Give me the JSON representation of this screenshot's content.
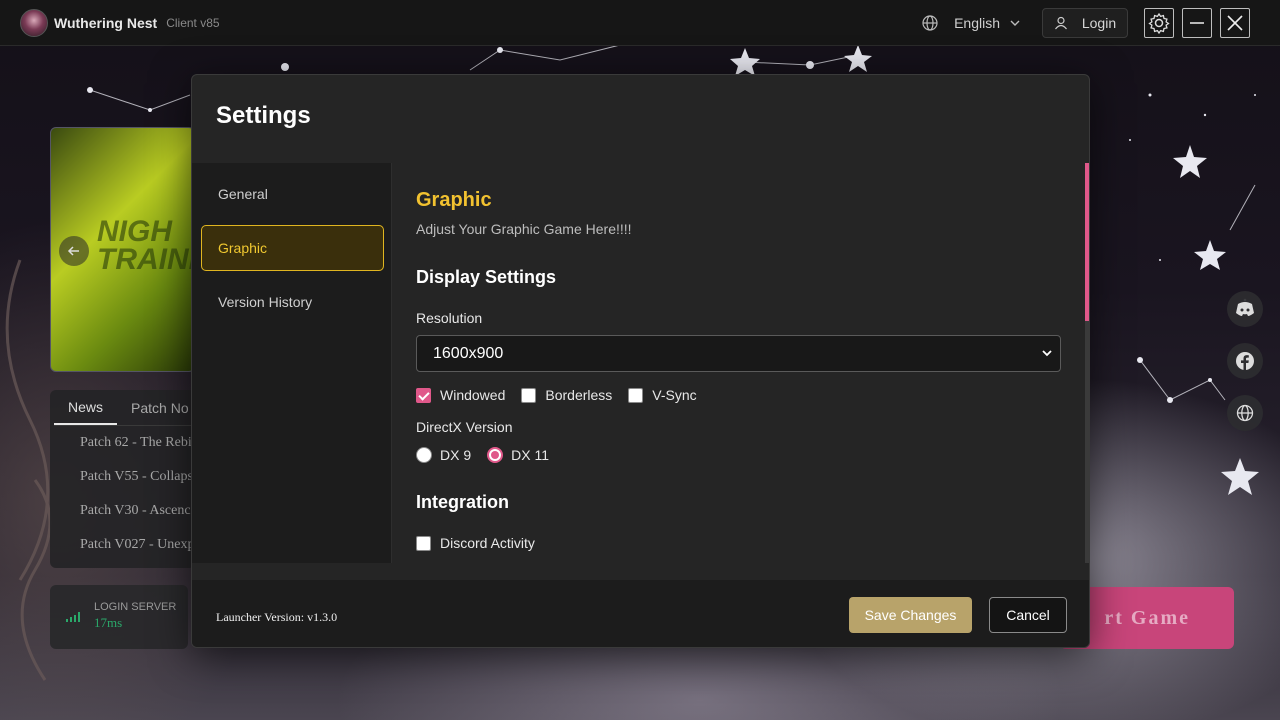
{
  "app": {
    "title": "Wuthering Nest",
    "client_version": "Client v85"
  },
  "topbar": {
    "language": "English",
    "login_label": "Login"
  },
  "banner": {
    "text": "NIGH\nTRAINI"
  },
  "news": {
    "tabs": [
      "News",
      "Patch No"
    ],
    "items": [
      "Patch 62 - The Rebi",
      "Patch V55 - Collaps",
      "Patch V30 - Ascenc",
      "Patch V027 - Unexp"
    ]
  },
  "server": {
    "label": "LOGIN SERVER",
    "ping": "17ms"
  },
  "start_button": {
    "label": "rt Game"
  },
  "settings": {
    "title": "Settings",
    "nav": [
      "General",
      "Graphic",
      "Version History"
    ],
    "active_nav": "Graphic",
    "section_title": "Graphic",
    "section_subtitle": "Adjust Your Graphic Game Here!!!!",
    "display_heading": "Display Settings",
    "resolution_label": "Resolution",
    "resolution_value": "1600x900",
    "checkboxes": [
      {
        "label": "Windowed",
        "checked": true
      },
      {
        "label": "Borderless",
        "checked": false
      },
      {
        "label": "V-Sync",
        "checked": false
      }
    ],
    "directx_label": "DirectX Version",
    "directx_options": [
      {
        "label": "DX 9",
        "selected": false
      },
      {
        "label": "DX 11",
        "selected": true
      }
    ],
    "integration_heading": "Integration",
    "discord_activity": {
      "label": "Discord Activity",
      "checked": false
    },
    "launcher_version": "Launcher Version: v1.3.0",
    "save_label": "Save Changes",
    "cancel_label": "Cancel"
  },
  "colors": {
    "accent_pink": "#e0588a",
    "accent_gold": "#f2c230",
    "save_btn": "#b8a36a"
  }
}
